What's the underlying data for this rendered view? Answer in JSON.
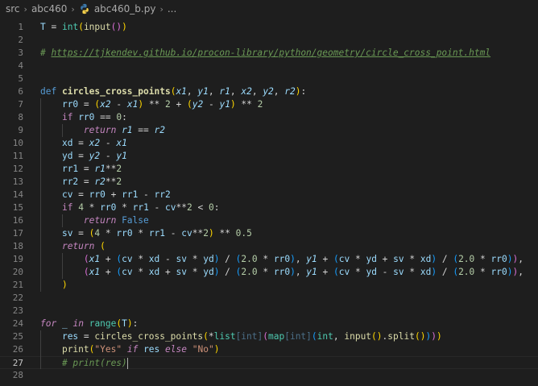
{
  "breadcrumb": {
    "folder1": "src",
    "folder2": "abc460",
    "file": "abc460_b.py",
    "more": "..."
  },
  "gutter": {
    "active_line": 27
  },
  "lines": [
    {
      "n": "1",
      "tokens": [
        {
          "t": "T",
          "c": "var"
        },
        {
          "t": " = ",
          "c": "op"
        },
        {
          "t": "int",
          "c": "cls"
        },
        {
          "t": "(",
          "c": "b1"
        },
        {
          "t": "input",
          "c": "fn"
        },
        {
          "t": "()",
          "c": "b2"
        },
        {
          "t": ")",
          "c": "b1"
        }
      ]
    },
    {
      "n": "2",
      "tokens": []
    },
    {
      "n": "3",
      "tokens": [
        {
          "t": "# ",
          "c": "com"
        },
        {
          "t": "https://tjkendev.github.io/procon-library/python/geometry/circle_cross_point.html",
          "c": "link"
        }
      ]
    },
    {
      "n": "4",
      "tokens": []
    },
    {
      "n": "5",
      "tokens": []
    },
    {
      "n": "6",
      "tokens": [
        {
          "t": "def",
          "c": "kw"
        },
        {
          "t": " ",
          "c": "op"
        },
        {
          "t": "circles_cross_points",
          "c": "fnb"
        },
        {
          "t": "(",
          "c": "b1"
        },
        {
          "t": "x1",
          "c": "par"
        },
        {
          "t": ", ",
          "c": "op"
        },
        {
          "t": "y1",
          "c": "par"
        },
        {
          "t": ", ",
          "c": "op"
        },
        {
          "t": "r1",
          "c": "par"
        },
        {
          "t": ", ",
          "c": "op"
        },
        {
          "t": "x2",
          "c": "par"
        },
        {
          "t": ", ",
          "c": "op"
        },
        {
          "t": "y2",
          "c": "par"
        },
        {
          "t": ", ",
          "c": "op"
        },
        {
          "t": "r2",
          "c": "par"
        },
        {
          "t": ")",
          "c": "b1"
        },
        {
          "t": ":",
          "c": "op"
        }
      ]
    },
    {
      "n": "7",
      "tokens": [
        {
          "t": "    ",
          "c": "op"
        },
        {
          "t": "rr0",
          "c": "var"
        },
        {
          "t": " = ",
          "c": "op"
        },
        {
          "t": "(",
          "c": "b1"
        },
        {
          "t": "x2",
          "c": "par"
        },
        {
          "t": " - ",
          "c": "op"
        },
        {
          "t": "x1",
          "c": "par"
        },
        {
          "t": ")",
          "c": "b1"
        },
        {
          "t": " ** ",
          "c": "op"
        },
        {
          "t": "2",
          "c": "num"
        },
        {
          "t": " + ",
          "c": "op"
        },
        {
          "t": "(",
          "c": "b1"
        },
        {
          "t": "y2",
          "c": "par"
        },
        {
          "t": " - ",
          "c": "op"
        },
        {
          "t": "y1",
          "c": "par"
        },
        {
          "t": ")",
          "c": "b1"
        },
        {
          "t": " ** ",
          "c": "op"
        },
        {
          "t": "2",
          "c": "num"
        }
      ]
    },
    {
      "n": "8",
      "tokens": [
        {
          "t": "    ",
          "c": "op"
        },
        {
          "t": "if",
          "c": "ctl"
        },
        {
          "t": " ",
          "c": "op"
        },
        {
          "t": "rr0",
          "c": "var"
        },
        {
          "t": " == ",
          "c": "op"
        },
        {
          "t": "0",
          "c": "num"
        },
        {
          "t": ":",
          "c": "op"
        }
      ]
    },
    {
      "n": "9",
      "tokens": [
        {
          "t": "        ",
          "c": "op"
        },
        {
          "t": "return",
          "c": "ctl-i"
        },
        {
          "t": " ",
          "c": "op"
        },
        {
          "t": "r1",
          "c": "par"
        },
        {
          "t": " == ",
          "c": "op"
        },
        {
          "t": "r2",
          "c": "par"
        }
      ]
    },
    {
      "n": "10",
      "tokens": [
        {
          "t": "    ",
          "c": "op"
        },
        {
          "t": "xd",
          "c": "var"
        },
        {
          "t": " = ",
          "c": "op"
        },
        {
          "t": "x2",
          "c": "par"
        },
        {
          "t": " - ",
          "c": "op"
        },
        {
          "t": "x1",
          "c": "par"
        }
      ]
    },
    {
      "n": "11",
      "tokens": [
        {
          "t": "    ",
          "c": "op"
        },
        {
          "t": "yd",
          "c": "var"
        },
        {
          "t": " = ",
          "c": "op"
        },
        {
          "t": "y2",
          "c": "par"
        },
        {
          "t": " - ",
          "c": "op"
        },
        {
          "t": "y1",
          "c": "par"
        }
      ]
    },
    {
      "n": "12",
      "tokens": [
        {
          "t": "    ",
          "c": "op"
        },
        {
          "t": "rr1",
          "c": "var"
        },
        {
          "t": " = ",
          "c": "op"
        },
        {
          "t": "r1",
          "c": "par"
        },
        {
          "t": "**",
          "c": "op"
        },
        {
          "t": "2",
          "c": "num"
        }
      ]
    },
    {
      "n": "13",
      "tokens": [
        {
          "t": "    ",
          "c": "op"
        },
        {
          "t": "rr2",
          "c": "var"
        },
        {
          "t": " = ",
          "c": "op"
        },
        {
          "t": "r2",
          "c": "par"
        },
        {
          "t": "**",
          "c": "op"
        },
        {
          "t": "2",
          "c": "num"
        }
      ]
    },
    {
      "n": "14",
      "tokens": [
        {
          "t": "    ",
          "c": "op"
        },
        {
          "t": "cv",
          "c": "var"
        },
        {
          "t": " = ",
          "c": "op"
        },
        {
          "t": "rr0",
          "c": "var"
        },
        {
          "t": " + ",
          "c": "op"
        },
        {
          "t": "rr1",
          "c": "var"
        },
        {
          "t": " - ",
          "c": "op"
        },
        {
          "t": "rr2",
          "c": "var"
        }
      ]
    },
    {
      "n": "15",
      "tokens": [
        {
          "t": "    ",
          "c": "op"
        },
        {
          "t": "if",
          "c": "ctl"
        },
        {
          "t": " ",
          "c": "op"
        },
        {
          "t": "4",
          "c": "num"
        },
        {
          "t": " * ",
          "c": "op"
        },
        {
          "t": "rr0",
          "c": "var"
        },
        {
          "t": " * ",
          "c": "op"
        },
        {
          "t": "rr1",
          "c": "var"
        },
        {
          "t": " - ",
          "c": "op"
        },
        {
          "t": "cv",
          "c": "var"
        },
        {
          "t": "**",
          "c": "op"
        },
        {
          "t": "2",
          "c": "num"
        },
        {
          "t": " < ",
          "c": "op"
        },
        {
          "t": "0",
          "c": "num"
        },
        {
          "t": ":",
          "c": "op"
        }
      ]
    },
    {
      "n": "16",
      "tokens": [
        {
          "t": "        ",
          "c": "op"
        },
        {
          "t": "return",
          "c": "ctl-i"
        },
        {
          "t": " ",
          "c": "op"
        },
        {
          "t": "False",
          "c": "kw"
        }
      ]
    },
    {
      "n": "17",
      "tokens": [
        {
          "t": "    ",
          "c": "op"
        },
        {
          "t": "sv",
          "c": "var"
        },
        {
          "t": " = ",
          "c": "op"
        },
        {
          "t": "(",
          "c": "b1"
        },
        {
          "t": "4",
          "c": "num"
        },
        {
          "t": " * ",
          "c": "op"
        },
        {
          "t": "rr0",
          "c": "var"
        },
        {
          "t": " * ",
          "c": "op"
        },
        {
          "t": "rr1",
          "c": "var"
        },
        {
          "t": " - ",
          "c": "op"
        },
        {
          "t": "cv",
          "c": "var"
        },
        {
          "t": "**",
          "c": "op"
        },
        {
          "t": "2",
          "c": "num"
        },
        {
          "t": ")",
          "c": "b1"
        },
        {
          "t": " ** ",
          "c": "op"
        },
        {
          "t": "0.5",
          "c": "num"
        }
      ]
    },
    {
      "n": "18",
      "tokens": [
        {
          "t": "    ",
          "c": "op"
        },
        {
          "t": "return",
          "c": "ctl-i"
        },
        {
          "t": " ",
          "c": "op"
        },
        {
          "t": "(",
          "c": "b1"
        }
      ]
    },
    {
      "n": "19",
      "tokens": [
        {
          "t": "        ",
          "c": "op"
        },
        {
          "t": "(",
          "c": "b2"
        },
        {
          "t": "x1",
          "c": "par"
        },
        {
          "t": " + ",
          "c": "op"
        },
        {
          "t": "(",
          "c": "b3"
        },
        {
          "t": "cv",
          "c": "var"
        },
        {
          "t": " * ",
          "c": "op"
        },
        {
          "t": "xd",
          "c": "var"
        },
        {
          "t": " - ",
          "c": "op"
        },
        {
          "t": "sv",
          "c": "var"
        },
        {
          "t": " * ",
          "c": "op"
        },
        {
          "t": "yd",
          "c": "var"
        },
        {
          "t": ")",
          "c": "b3"
        },
        {
          "t": " / ",
          "c": "op"
        },
        {
          "t": "(",
          "c": "b3"
        },
        {
          "t": "2.0",
          "c": "num"
        },
        {
          "t": " * ",
          "c": "op"
        },
        {
          "t": "rr0",
          "c": "var"
        },
        {
          "t": ")",
          "c": "b3"
        },
        {
          "t": ", ",
          "c": "op"
        },
        {
          "t": "y1",
          "c": "par"
        },
        {
          "t": " + ",
          "c": "op"
        },
        {
          "t": "(",
          "c": "b3"
        },
        {
          "t": "cv",
          "c": "var"
        },
        {
          "t": " * ",
          "c": "op"
        },
        {
          "t": "yd",
          "c": "var"
        },
        {
          "t": " + ",
          "c": "op"
        },
        {
          "t": "sv",
          "c": "var"
        },
        {
          "t": " * ",
          "c": "op"
        },
        {
          "t": "xd",
          "c": "var"
        },
        {
          "t": ")",
          "c": "b3"
        },
        {
          "t": " / ",
          "c": "op"
        },
        {
          "t": "(",
          "c": "b3"
        },
        {
          "t": "2.0",
          "c": "num"
        },
        {
          "t": " * ",
          "c": "op"
        },
        {
          "t": "rr0",
          "c": "var"
        },
        {
          "t": ")",
          "c": "b3"
        },
        {
          "t": ")",
          "c": "b2"
        },
        {
          "t": ",",
          "c": "op"
        }
      ]
    },
    {
      "n": "20",
      "tokens": [
        {
          "t": "        ",
          "c": "op"
        },
        {
          "t": "(",
          "c": "b2"
        },
        {
          "t": "x1",
          "c": "par"
        },
        {
          "t": " + ",
          "c": "op"
        },
        {
          "t": "(",
          "c": "b3"
        },
        {
          "t": "cv",
          "c": "var"
        },
        {
          "t": " * ",
          "c": "op"
        },
        {
          "t": "xd",
          "c": "var"
        },
        {
          "t": " + ",
          "c": "op"
        },
        {
          "t": "sv",
          "c": "var"
        },
        {
          "t": " * ",
          "c": "op"
        },
        {
          "t": "yd",
          "c": "var"
        },
        {
          "t": ")",
          "c": "b3"
        },
        {
          "t": " / ",
          "c": "op"
        },
        {
          "t": "(",
          "c": "b3"
        },
        {
          "t": "2.0",
          "c": "num"
        },
        {
          "t": " * ",
          "c": "op"
        },
        {
          "t": "rr0",
          "c": "var"
        },
        {
          "t": ")",
          "c": "b3"
        },
        {
          "t": ", ",
          "c": "op"
        },
        {
          "t": "y1",
          "c": "par"
        },
        {
          "t": " + ",
          "c": "op"
        },
        {
          "t": "(",
          "c": "b3"
        },
        {
          "t": "cv",
          "c": "var"
        },
        {
          "t": " * ",
          "c": "op"
        },
        {
          "t": "yd",
          "c": "var"
        },
        {
          "t": " - ",
          "c": "op"
        },
        {
          "t": "sv",
          "c": "var"
        },
        {
          "t": " * ",
          "c": "op"
        },
        {
          "t": "xd",
          "c": "var"
        },
        {
          "t": ")",
          "c": "b3"
        },
        {
          "t": " / ",
          "c": "op"
        },
        {
          "t": "(",
          "c": "b3"
        },
        {
          "t": "2.0",
          "c": "num"
        },
        {
          "t": " * ",
          "c": "op"
        },
        {
          "t": "rr0",
          "c": "var"
        },
        {
          "t": ")",
          "c": "b3"
        },
        {
          "t": ")",
          "c": "b2"
        },
        {
          "t": ",",
          "c": "op"
        }
      ]
    },
    {
      "n": "21",
      "tokens": [
        {
          "t": "    ",
          "c": "op"
        },
        {
          "t": ")",
          "c": "b1"
        }
      ]
    },
    {
      "n": "22",
      "tokens": []
    },
    {
      "n": "23",
      "tokens": []
    },
    {
      "n": "24",
      "tokens": [
        {
          "t": "for",
          "c": "ctl-i"
        },
        {
          "t": " ",
          "c": "op"
        },
        {
          "t": "_",
          "c": "var"
        },
        {
          "t": " ",
          "c": "op"
        },
        {
          "t": "in",
          "c": "ctl-i"
        },
        {
          "t": " ",
          "c": "op"
        },
        {
          "t": "range",
          "c": "cls"
        },
        {
          "t": "(",
          "c": "b1"
        },
        {
          "t": "T",
          "c": "var"
        },
        {
          "t": ")",
          "c": "b1"
        },
        {
          "t": ":",
          "c": "op"
        }
      ]
    },
    {
      "n": "25",
      "tokens": [
        {
          "t": "    ",
          "c": "op"
        },
        {
          "t": "res",
          "c": "var"
        },
        {
          "t": " = ",
          "c": "op"
        },
        {
          "t": "circles_cross_points",
          "c": "fn"
        },
        {
          "t": "(",
          "c": "b1"
        },
        {
          "t": "*",
          "c": "op"
        },
        {
          "t": "list",
          "c": "cls"
        },
        {
          "t": "[int]",
          "c": "dim"
        },
        {
          "t": "(",
          "c": "b2"
        },
        {
          "t": "map",
          "c": "cls"
        },
        {
          "t": "[int]",
          "c": "dim"
        },
        {
          "t": "(",
          "c": "b3"
        },
        {
          "t": "int",
          "c": "cls"
        },
        {
          "t": ", ",
          "c": "op"
        },
        {
          "t": "input",
          "c": "fn"
        },
        {
          "t": "()",
          "c": "b1"
        },
        {
          "t": ".",
          "c": "op"
        },
        {
          "t": "split",
          "c": "fn"
        },
        {
          "t": "()",
          "c": "b1"
        },
        {
          "t": ")",
          "c": "b3"
        },
        {
          "t": ")",
          "c": "b2"
        },
        {
          "t": ")",
          "c": "b1"
        }
      ]
    },
    {
      "n": "26",
      "tokens": [
        {
          "t": "    ",
          "c": "op"
        },
        {
          "t": "print",
          "c": "fn"
        },
        {
          "t": "(",
          "c": "b1"
        },
        {
          "t": "\"Yes\"",
          "c": "str"
        },
        {
          "t": " ",
          "c": "op"
        },
        {
          "t": "if",
          "c": "ctl-i"
        },
        {
          "t": " ",
          "c": "op"
        },
        {
          "t": "res",
          "c": "var"
        },
        {
          "t": " ",
          "c": "op"
        },
        {
          "t": "else",
          "c": "ctl-i"
        },
        {
          "t": " ",
          "c": "op"
        },
        {
          "t": "\"No\"",
          "c": "str"
        },
        {
          "t": ")",
          "c": "b1"
        }
      ]
    },
    {
      "n": "27",
      "tokens": [
        {
          "t": "    ",
          "c": "op"
        },
        {
          "t": "# print(res)",
          "c": "com"
        }
      ],
      "cursor": true
    },
    {
      "n": "28",
      "tokens": []
    }
  ]
}
